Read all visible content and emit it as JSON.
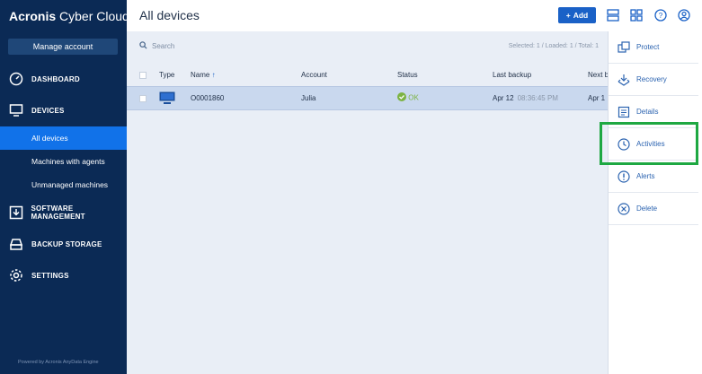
{
  "sidebar": {
    "logo": {
      "brand": "Acronis",
      "product": " Cyber Cloud"
    },
    "manage_account": "Manage account",
    "nav": [
      {
        "label": "DASHBOARD",
        "icon": "dashboard-icon"
      },
      {
        "label": "DEVICES",
        "icon": "monitor-icon"
      },
      {
        "label": "SOFTWARE MANAGEMENT",
        "icon": "software-download-icon"
      },
      {
        "label": "BACKUP STORAGE",
        "icon": "storage-icon"
      },
      {
        "label": "SETTINGS",
        "icon": "gear-icon"
      }
    ],
    "devices_sub": [
      {
        "label": "All devices",
        "active": true
      },
      {
        "label": "Machines with agents",
        "active": false
      },
      {
        "label": "Unmanaged machines",
        "active": false
      }
    ],
    "powered_by": "Powered by Acronis AnyData Engine"
  },
  "header": {
    "title": "All devices",
    "add_label": "Add",
    "icons": [
      "list-view-icon",
      "grid-view-icon",
      "help-icon",
      "account-icon"
    ]
  },
  "toolbar": {
    "search_placeholder": "Search",
    "counts": "Selected: 1 / Loaded: 1 / Total: 1"
  },
  "table": {
    "columns": [
      "Type",
      "Name",
      "Account",
      "Status",
      "Last backup",
      "Next b"
    ],
    "sort_indicator": "↑",
    "rows": [
      {
        "name": "O0001860",
        "account": "Julia",
        "status": "OK",
        "last_backup_date": "Apr 12",
        "last_backup_time": "08:36:45 PM",
        "next_backup": "Apr 1"
      }
    ]
  },
  "actions": [
    {
      "label": "Protect",
      "icon": "protect-icon"
    },
    {
      "label": "Recovery",
      "icon": "recovery-icon"
    },
    {
      "label": "Details",
      "icon": "details-icon"
    },
    {
      "label": "Activities",
      "icon": "clock-icon"
    },
    {
      "label": "Alerts",
      "icon": "alert-icon"
    },
    {
      "label": "Delete",
      "icon": "delete-icon"
    }
  ],
  "colors": {
    "sidebar_bg": "#0b2a55",
    "active_item": "#1172e9",
    "accent_button": "#1a61c7",
    "status_ok": "#7cb342",
    "highlight_box": "#1ea842"
  }
}
